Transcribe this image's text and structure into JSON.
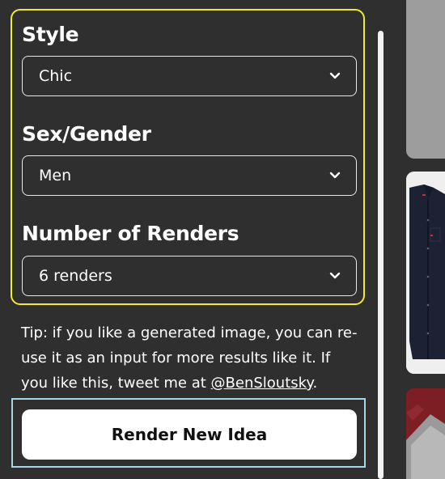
{
  "settings": {
    "style": {
      "title": "Style",
      "value": "Chic"
    },
    "gender": {
      "title": "Sex/Gender",
      "value": "Men"
    },
    "renders": {
      "title": "Number of Renders",
      "value": "6 renders"
    }
  },
  "tip": {
    "text": "Tip: if you like a generated image, you can re-use it as an input for more results like it. If you like this, tweet me at ",
    "handle": "@BenSloutsky",
    "end": "."
  },
  "render_button": {
    "label": "Render New Idea"
  },
  "icons": {
    "dropdown": "chevron-down-icon"
  },
  "colors": {
    "background": "#2f2f2f",
    "settings_border": "#f2ea2f",
    "button_wrap_border": "#a9d6e6",
    "shirt_color": "#1c2233",
    "red_fabric": "#7c1e24"
  }
}
